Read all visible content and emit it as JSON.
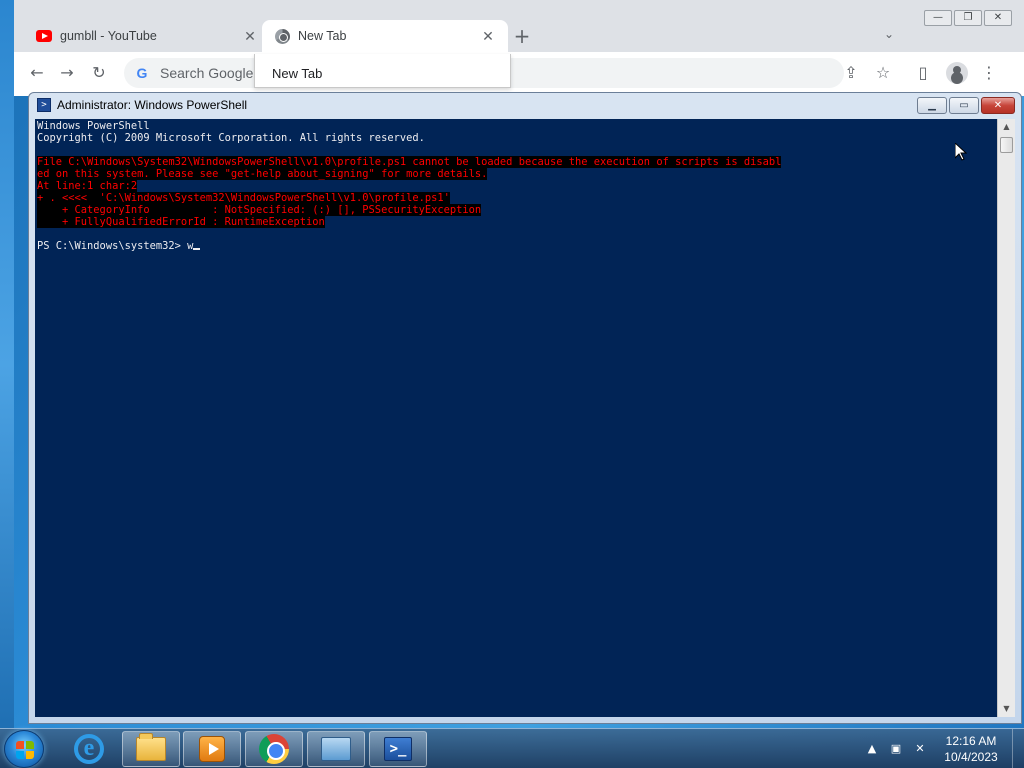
{
  "browser": {
    "tabs": [
      {
        "title": "gumbll - YouTube",
        "icon": "youtube-icon"
      },
      {
        "title": "New Tab",
        "icon": "chrome-icon"
      }
    ],
    "omnibox_placeholder": "Search Google o",
    "suggestion": "New Tab"
  },
  "powershell": {
    "window_title": "Administrator: Windows PowerShell",
    "lines": [
      {
        "text": "Windows PowerShell",
        "type": "normal"
      },
      {
        "text": "Copyright (C) 2009 Microsoft Corporation. All rights reserved.",
        "type": "normal"
      },
      {
        "text": "",
        "type": "normal"
      },
      {
        "text": "File C:\\Windows\\System32\\WindowsPowerShell\\v1.0\\profile.ps1 cannot be loaded because the execution of scripts is disabl",
        "type": "error"
      },
      {
        "text": "ed on this system. Please see \"get-help about_signing\" for more details.",
        "type": "error"
      },
      {
        "text": "At line:1 char:2",
        "type": "error"
      },
      {
        "text": "+ . <<<<  'C:\\Windows\\System32\\WindowsPowerShell\\v1.0\\profile.ps1'",
        "type": "error"
      },
      {
        "text": "    + CategoryInfo          : NotSpecified: (:) [], PSSecurityException",
        "type": "error"
      },
      {
        "text": "    + FullyQualifiedErrorId : RuntimeException",
        "type": "error"
      },
      {
        "text": "",
        "type": "normal"
      }
    ],
    "prompt": "PS C:\\Windows\\system32> ",
    "input": "w",
    "colors": {
      "background": "#012456",
      "foreground": "#eeedf0",
      "error": "#ff0000"
    }
  },
  "taskbar": {
    "apps": [
      "internet-explorer-icon",
      "windows-explorer-icon",
      "media-player-icon",
      "chrome-icon",
      "remote-desktop-icon",
      "powershell-icon"
    ],
    "clock_time": "12:16 AM",
    "clock_date": "10/4/2023"
  }
}
